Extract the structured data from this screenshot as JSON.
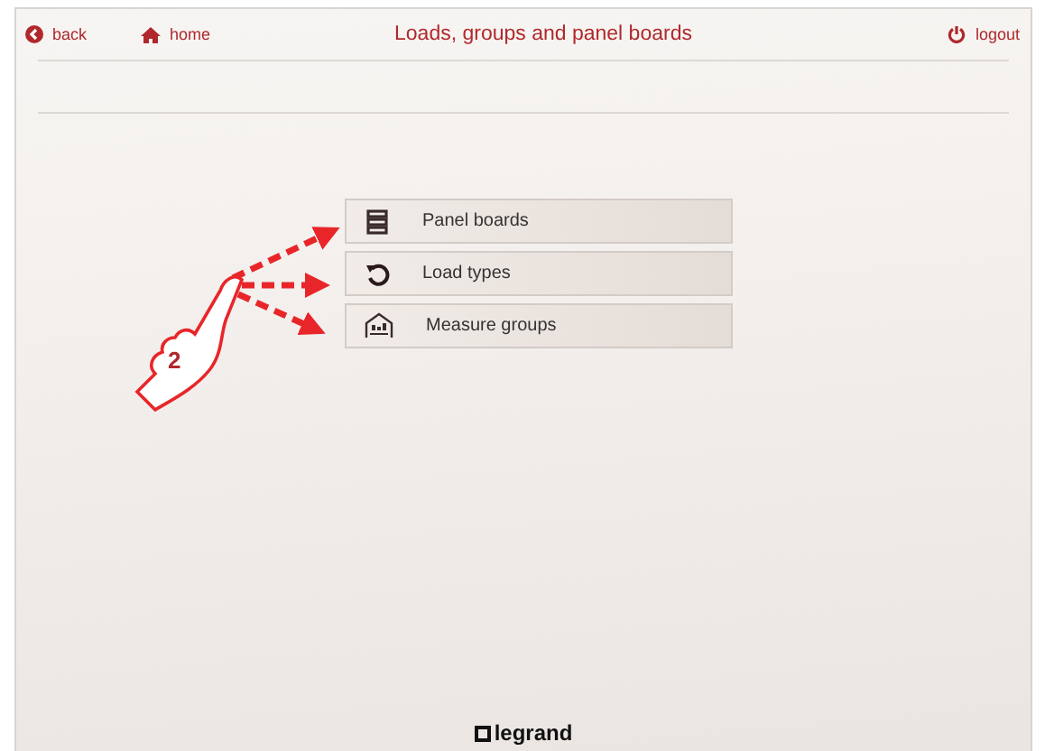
{
  "header": {
    "back": "back",
    "home": "home",
    "title": "Loads, groups and panel boards",
    "logout": "logout"
  },
  "menu": [
    {
      "kind": "panels",
      "label": "Panel boards"
    },
    {
      "kind": "loads",
      "label": "Load types"
    },
    {
      "kind": "groups",
      "label": "Measure groups"
    }
  ],
  "annotation": {
    "step": "2"
  },
  "footer": {
    "brand": "legrand"
  }
}
